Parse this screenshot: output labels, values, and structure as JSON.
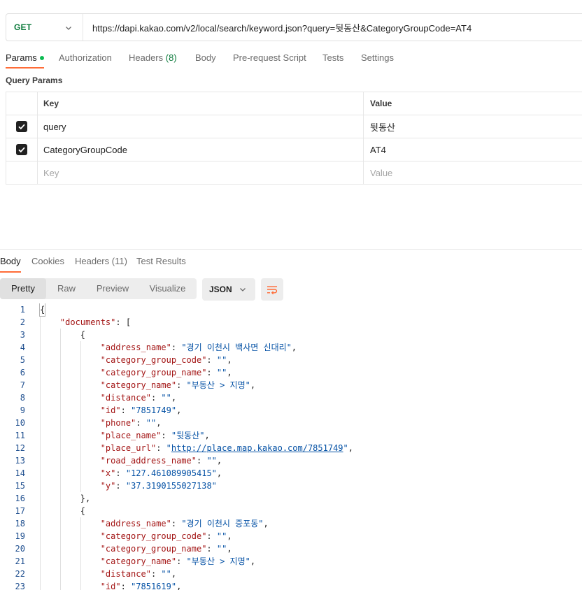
{
  "request": {
    "method": "GET",
    "url": "https://dapi.kakao.com/v2/local/search/keyword.json?query=뒷동산&CategoryGroupCode=AT4"
  },
  "request_tabs": [
    {
      "label": "Params",
      "active": true,
      "has_dot": true
    },
    {
      "label": "Authorization"
    },
    {
      "label": "Headers",
      "count": "(8)"
    },
    {
      "label": "Body"
    },
    {
      "label": "Pre-request Script"
    },
    {
      "label": "Tests"
    },
    {
      "label": "Settings"
    }
  ],
  "query_params": {
    "title": "Query Params",
    "headers": {
      "key": "Key",
      "value": "Value"
    },
    "rows": [
      {
        "checked": true,
        "key": "query",
        "value": "뒷동산"
      },
      {
        "checked": true,
        "key": "CategoryGroupCode",
        "value": "AT4"
      }
    ],
    "placeholder": {
      "key": "Key",
      "value": "Value"
    }
  },
  "response_tabs": [
    {
      "label": "Body",
      "active": true
    },
    {
      "label": "Cookies"
    },
    {
      "label": "Headers (11)"
    },
    {
      "label": "Test Results"
    }
  ],
  "view_modes": [
    {
      "label": "Pretty",
      "active": true
    },
    {
      "label": "Raw"
    },
    {
      "label": "Preview"
    },
    {
      "label": "Visualize"
    }
  ],
  "format": "JSON",
  "icons": {
    "chevron": "chevron-down-icon",
    "wrap": "wrap-lines-icon",
    "check": "check-icon"
  },
  "colors": {
    "accent": "#ff6c37",
    "get": "#0b7a3b",
    "key": "#a31515",
    "string": "#0451a5"
  },
  "code_lines": [
    {
      "n": "1",
      "t": [
        [
          "p",
          "{"
        ]
      ]
    },
    {
      "n": "2",
      "t": [
        [
          "p",
          "    "
        ],
        [
          "k",
          "\"documents\""
        ],
        [
          "p",
          ": ["
        ]
      ]
    },
    {
      "n": "3",
      "t": [
        [
          "p",
          "        {"
        ]
      ]
    },
    {
      "n": "4",
      "t": [
        [
          "p",
          "            "
        ],
        [
          "k",
          "\"address_name\""
        ],
        [
          "p",
          ": "
        ],
        [
          "s",
          "\"경기 이천시 백사면 신대리\""
        ],
        [
          "p",
          ","
        ]
      ]
    },
    {
      "n": "5",
      "t": [
        [
          "p",
          "            "
        ],
        [
          "k",
          "\"category_group_code\""
        ],
        [
          "p",
          ": "
        ],
        [
          "s",
          "\"\""
        ],
        [
          "p",
          ","
        ]
      ]
    },
    {
      "n": "6",
      "t": [
        [
          "p",
          "            "
        ],
        [
          "k",
          "\"category_group_name\""
        ],
        [
          "p",
          ": "
        ],
        [
          "s",
          "\"\""
        ],
        [
          "p",
          ","
        ]
      ]
    },
    {
      "n": "7",
      "t": [
        [
          "p",
          "            "
        ],
        [
          "k",
          "\"category_name\""
        ],
        [
          "p",
          ": "
        ],
        [
          "s",
          "\"부동산 > 지명\""
        ],
        [
          "p",
          ","
        ]
      ]
    },
    {
      "n": "8",
      "t": [
        [
          "p",
          "            "
        ],
        [
          "k",
          "\"distance\""
        ],
        [
          "p",
          ": "
        ],
        [
          "s",
          "\"\""
        ],
        [
          "p",
          ","
        ]
      ]
    },
    {
      "n": "9",
      "t": [
        [
          "p",
          "            "
        ],
        [
          "k",
          "\"id\""
        ],
        [
          "p",
          ": "
        ],
        [
          "s",
          "\"7851749\""
        ],
        [
          "p",
          ","
        ]
      ]
    },
    {
      "n": "10",
      "t": [
        [
          "p",
          "            "
        ],
        [
          "k",
          "\"phone\""
        ],
        [
          "p",
          ": "
        ],
        [
          "s",
          "\"\""
        ],
        [
          "p",
          ","
        ]
      ]
    },
    {
      "n": "11",
      "t": [
        [
          "p",
          "            "
        ],
        [
          "k",
          "\"place_name\""
        ],
        [
          "p",
          ": "
        ],
        [
          "s",
          "\"뒷동산\""
        ],
        [
          "p",
          ","
        ]
      ]
    },
    {
      "n": "12",
      "t": [
        [
          "p",
          "            "
        ],
        [
          "k",
          "\"place_url\""
        ],
        [
          "p",
          ": "
        ],
        [
          "s",
          "\""
        ],
        [
          "u",
          "http://place.map.kakao.com/7851749"
        ],
        [
          "s",
          "\""
        ],
        [
          "p",
          ","
        ]
      ]
    },
    {
      "n": "13",
      "t": [
        [
          "p",
          "            "
        ],
        [
          "k",
          "\"road_address_name\""
        ],
        [
          "p",
          ": "
        ],
        [
          "s",
          "\"\""
        ],
        [
          "p",
          ","
        ]
      ]
    },
    {
      "n": "14",
      "t": [
        [
          "p",
          "            "
        ],
        [
          "k",
          "\"x\""
        ],
        [
          "p",
          ": "
        ],
        [
          "s",
          "\"127.461089905415\""
        ],
        [
          "p",
          ","
        ]
      ]
    },
    {
      "n": "15",
      "t": [
        [
          "p",
          "            "
        ],
        [
          "k",
          "\"y\""
        ],
        [
          "p",
          ": "
        ],
        [
          "s",
          "\"37.3190155027138\""
        ]
      ]
    },
    {
      "n": "16",
      "t": [
        [
          "p",
          "        },"
        ]
      ]
    },
    {
      "n": "17",
      "t": [
        [
          "p",
          "        {"
        ]
      ]
    },
    {
      "n": "18",
      "t": [
        [
          "p",
          "            "
        ],
        [
          "k",
          "\"address_name\""
        ],
        [
          "p",
          ": "
        ],
        [
          "s",
          "\"경기 이천시 증포동\""
        ],
        [
          "p",
          ","
        ]
      ]
    },
    {
      "n": "19",
      "t": [
        [
          "p",
          "            "
        ],
        [
          "k",
          "\"category_group_code\""
        ],
        [
          "p",
          ": "
        ],
        [
          "s",
          "\"\""
        ],
        [
          "p",
          ","
        ]
      ]
    },
    {
      "n": "20",
      "t": [
        [
          "p",
          "            "
        ],
        [
          "k",
          "\"category_group_name\""
        ],
        [
          "p",
          ": "
        ],
        [
          "s",
          "\"\""
        ],
        [
          "p",
          ","
        ]
      ]
    },
    {
      "n": "21",
      "t": [
        [
          "p",
          "            "
        ],
        [
          "k",
          "\"category_name\""
        ],
        [
          "p",
          ": "
        ],
        [
          "s",
          "\"부동산 > 지명\""
        ],
        [
          "p",
          ","
        ]
      ]
    },
    {
      "n": "22",
      "t": [
        [
          "p",
          "            "
        ],
        [
          "k",
          "\"distance\""
        ],
        [
          "p",
          ": "
        ],
        [
          "s",
          "\"\""
        ],
        [
          "p",
          ","
        ]
      ]
    },
    {
      "n": "23",
      "t": [
        [
          "p",
          "            "
        ],
        [
          "k",
          "\"id\""
        ],
        [
          "p",
          ": "
        ],
        [
          "s",
          "\"7851619\""
        ],
        [
          "p",
          ","
        ]
      ]
    }
  ]
}
